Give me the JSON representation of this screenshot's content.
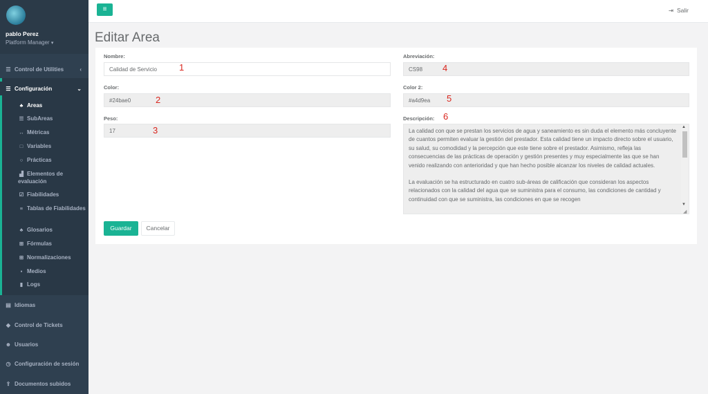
{
  "profile": {
    "name": "pablo Perez",
    "role": "Platform Manager"
  },
  "menu": {
    "control_utilities": "Control de Utilities",
    "configuracion": "Configuración",
    "idiomas": "Idiomas",
    "control_tickets": "Control de Tickets",
    "usuarios": "Usuarios",
    "config_sesion": "Configuración de sesión",
    "documentos": "Documentos subidos"
  },
  "submenu": [
    {
      "label": "Areas",
      "icon": "sitemap-icon"
    },
    {
      "label": "SubAreas",
      "icon": "list-icon"
    },
    {
      "label": "Métricas",
      "icon": "arrows-h-icon"
    },
    {
      "label": "Variables",
      "icon": "square-icon"
    },
    {
      "label": "Prácticas",
      "icon": "circle-icon"
    },
    {
      "label": "Elementos de evaluación",
      "icon": "bar-chart-icon"
    },
    {
      "label": "Fiabilidades",
      "icon": "check-square-icon"
    },
    {
      "label": "Tablas de Fiabilidades",
      "icon": "list-ol-icon"
    },
    {
      "label": "Glosarios",
      "icon": "sitemap-icon"
    },
    {
      "label": "Fórmulas",
      "icon": "plus-square-icon"
    },
    {
      "label": "Normalizaciones",
      "icon": "plus-square-icon"
    },
    {
      "label": "Medios",
      "icon": "tint-icon"
    },
    {
      "label": "Logs",
      "icon": "book-icon"
    }
  ],
  "topbar": {
    "logout_label": "Salir"
  },
  "page": {
    "title": "Editar Area"
  },
  "form": {
    "nombre_label": "Nombre:",
    "nombre_value": "Calidad de Servicio",
    "abreviacion_label": "Abreviación:",
    "abreviacion_value": "CS98",
    "color_label": "Color:",
    "color_value": "#24bae0",
    "color2_label": "Color 2:",
    "color2_value": "#a4d9ea",
    "peso_label": "Peso:",
    "peso_value": "17",
    "descripcion_label": "Descripción:",
    "descripcion_p1": "La calidad con que se prestan los servicios de agua y saneamiento es sin duda el elemento más concluyente de cuantos permiten evaluar la gestión del prestador. Esta calidad tiene un impacto directo sobre el usuario, su salud, su comodidad y la percepción que este tiene sobre el prestador. Asimismo, refleja las consecuencias de las prácticas de operación y gestión presentes y muy especialmente las que se han venido realizando con anterioridad y que han hecho posible alcanzar los niveles de calidad  actuales.",
    "descripcion_p2": "La evaluación se ha estructurado en cuatro sub-áreas de calificación que consideran los aspectos relacionados con la calidad del agua que se suministra para el consumo, las condiciones de cantidad y continuidad con que se suministra, las condiciones en que se recogen",
    "save_label": "Guardar",
    "cancel_label": "Cancelar"
  },
  "annotations": {
    "n1": "1",
    "n2": "2",
    "n3": "3",
    "n4": "4",
    "n5": "5",
    "n6": "6"
  },
  "colors": {
    "accent": "#1ab394",
    "sidebar": "#2f4050",
    "annotation": "#d9251d"
  }
}
